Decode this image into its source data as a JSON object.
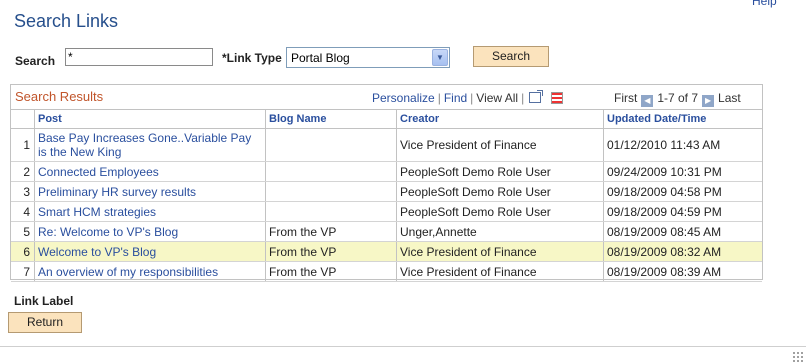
{
  "help_link": "Help",
  "page_title": "Search Links",
  "search": {
    "label": "Search",
    "value": "*"
  },
  "link_type": {
    "label": "*Link Type",
    "selected": "Portal Blog"
  },
  "search_button": "Search",
  "grid": {
    "title": "Search Results",
    "tools": {
      "personalize": "Personalize",
      "find": "Find",
      "view_all": "View All"
    },
    "nav": {
      "first": "First",
      "range": "1-7 of 7",
      "last": "Last"
    },
    "columns": [
      "Post",
      "Blog Name",
      "Creator",
      "Updated Date/Time"
    ],
    "rows": [
      {
        "num": "1",
        "post": "Base Pay Increases Gone..Variable Pay is the New King",
        "blog": "",
        "creator": "Vice President of Finance",
        "updated": "01/12/2010 11:43 AM"
      },
      {
        "num": "2",
        "post": "Connected Employees",
        "blog": "",
        "creator": "PeopleSoft Demo Role User",
        "updated": "09/24/2009 10:31 PM"
      },
      {
        "num": "3",
        "post": "Preliminary HR survey results",
        "blog": "",
        "creator": "PeopleSoft Demo Role User",
        "updated": "09/18/2009 04:58 PM"
      },
      {
        "num": "4",
        "post": "Smart HCM strategies",
        "blog": "",
        "creator": "PeopleSoft Demo Role User",
        "updated": "09/18/2009 04:59 PM"
      },
      {
        "num": "5",
        "post": "Re: Welcome to VP's Blog",
        "blog": "From the VP",
        "creator": "Unger,Annette",
        "updated": "08/19/2009 08:45 AM"
      },
      {
        "num": "6",
        "post": "Welcome to VP's Blog",
        "blog": "From the VP",
        "creator": "Vice President of Finance",
        "updated": "08/19/2009 08:32 AM"
      },
      {
        "num": "7",
        "post": "An overview of my responsibilities",
        "blog": "From the VP",
        "creator": "Vice President of Finance",
        "updated": "08/19/2009 08:39 AM"
      }
    ]
  },
  "link_label": "Link Label",
  "return_button": "Return",
  "colors": {
    "accent": "#264f8c",
    "link": "#2a4f9e",
    "grid_title": "#c1552b",
    "button_bg": "#fbe3bd",
    "highlight_row": "#f7f7c6"
  }
}
